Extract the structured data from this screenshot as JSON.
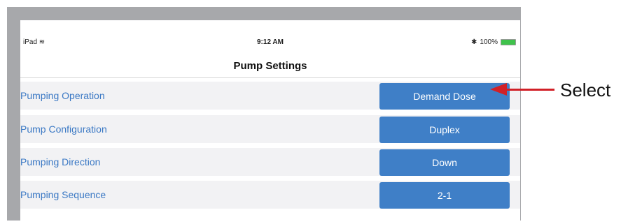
{
  "status_bar": {
    "device": "iPad",
    "wifi_icon": "≋",
    "time": "9:12 AM",
    "bluetooth_icon": "✱",
    "battery": "100%"
  },
  "nav": {
    "title": "Pump Settings"
  },
  "settings": [
    {
      "label": "Pumping Operation",
      "value": "Demand Dose"
    },
    {
      "label": "Pump Configuration",
      "value": "Duplex"
    },
    {
      "label": "Pumping Direction",
      "value": "Down"
    },
    {
      "label": "Pumping Sequence",
      "value": "2-1"
    }
  ],
  "annotation": {
    "text": "Select",
    "color": "#d12027"
  },
  "colors": {
    "button": "#3f7fc7",
    "label": "#3a78c4",
    "row": "#f2f2f4",
    "frame": "#a7a8ab"
  }
}
